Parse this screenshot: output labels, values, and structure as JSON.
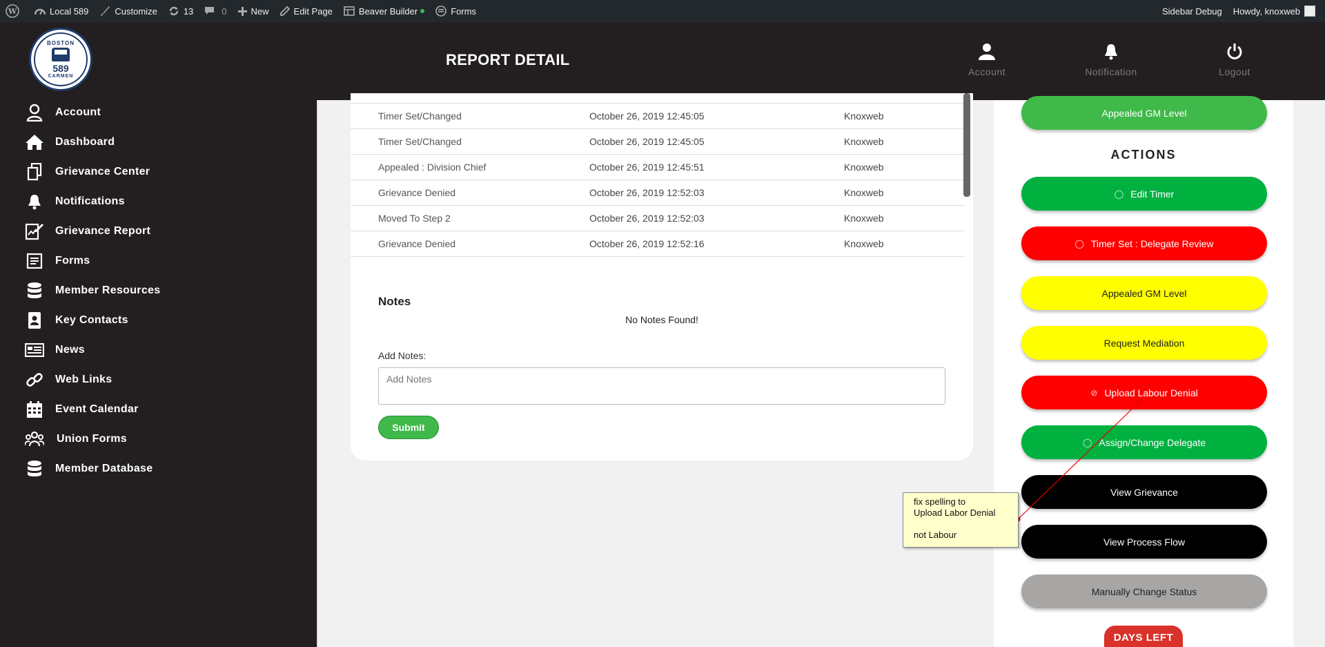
{
  "adminbar": {
    "site": "Local 589",
    "customize": "Customize",
    "updates": "13",
    "comments": "0",
    "new": "New",
    "edit_page": "Edit Page",
    "beaver": "Beaver Builder",
    "forms": "Forms",
    "sidebar_debug": "Sidebar Debug",
    "howdy": "Howdy, knoxweb"
  },
  "logo": {
    "top": "BOSTON",
    "number": "589",
    "bottom": "CARMEN"
  },
  "sidebar": {
    "items": [
      {
        "label": "Account",
        "icon": "user-icon"
      },
      {
        "label": "Dashboard",
        "icon": "home-icon"
      },
      {
        "label": "Grievance Center",
        "icon": "copy-icon"
      },
      {
        "label": "Notifications",
        "icon": "bell-icon"
      },
      {
        "label": "Grievance Report",
        "icon": "report-icon"
      },
      {
        "label": "Forms",
        "icon": "form-icon"
      },
      {
        "label": "Member Resources",
        "icon": "database-icon"
      },
      {
        "label": "Key Contacts",
        "icon": "contact-icon"
      },
      {
        "label": "News",
        "icon": "news-icon"
      },
      {
        "label": "Web Links",
        "icon": "link-icon"
      },
      {
        "label": "Event Calendar",
        "icon": "calendar-icon"
      },
      {
        "label": "Union Forms",
        "icon": "users-icon"
      },
      {
        "label": "Member Database",
        "icon": "database-icon"
      }
    ]
  },
  "header": {
    "title": "REPORT DETAIL",
    "account": "Account",
    "notification": "Notification",
    "logout": "Logout"
  },
  "log": {
    "rows": [
      {
        "action": "Timer Set/Changed",
        "date": "October 26, 2019 12:45:05",
        "user": "Knoxweb"
      },
      {
        "action": "Timer Set/Changed",
        "date": "October 26, 2019 12:45:05",
        "user": "Knoxweb"
      },
      {
        "action": "Appealed : Division Chief",
        "date": "October 26, 2019 12:45:51",
        "user": "Knoxweb"
      },
      {
        "action": "Grievance Denied",
        "date": "October 26, 2019 12:52:03",
        "user": "Knoxweb"
      },
      {
        "action": "Moved To Step 2",
        "date": "October 26, 2019 12:52:03",
        "user": "Knoxweb"
      },
      {
        "action": "Grievance Denied",
        "date": "October 26, 2019 12:52:16",
        "user": "Knoxweb"
      }
    ]
  },
  "notes": {
    "title": "Notes",
    "empty": "No Notes Found!",
    "add_label": "Add Notes:",
    "placeholder": "Add Notes",
    "submit": "Submit"
  },
  "actions": {
    "title": "ACTIONS",
    "top_button": "Appealed GM Level",
    "buttons": [
      {
        "label": "Edit Timer"
      },
      {
        "label": "Timer Set : Delegate Review"
      },
      {
        "label": "Appealed GM Level"
      },
      {
        "label": "Request Mediation"
      },
      {
        "label": "Upload Labour Denial"
      },
      {
        "label": "Assign/Change Delegate"
      },
      {
        "label": "View Grievance"
      },
      {
        "label": "View Process Flow"
      },
      {
        "label": "Manually Change Status"
      }
    ],
    "days_left": "DAYS LEFT"
  },
  "annotation": {
    "line1": "fix spelling to",
    "line2": "Upload Labor Denial",
    "line3": "not Labour"
  },
  "colors": {
    "green": "#00b140",
    "red": "#ff0000",
    "yellow": "#ffff00",
    "black": "#000000",
    "gray": "#a8a5a5",
    "dark": "#231f20"
  }
}
